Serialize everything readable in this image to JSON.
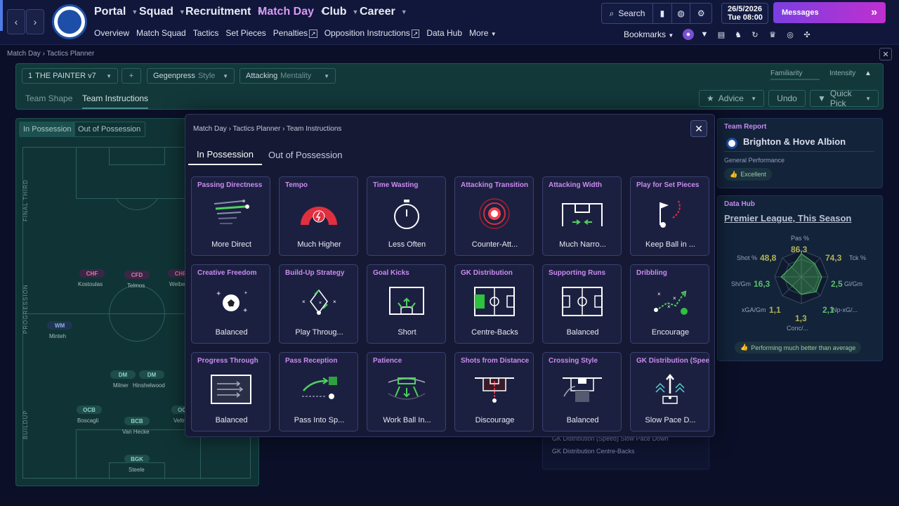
{
  "topnav": {
    "items": [
      "Portal",
      "Squad",
      "Recruitment",
      "Match Day",
      "Club",
      "Career"
    ],
    "active": "Match Day",
    "subnav": [
      "Overview",
      "Match Squad",
      "Tactics",
      "Set Pieces",
      "Penalties",
      "Opposition Instructions",
      "Data Hub",
      "More"
    ],
    "search_label": "Search",
    "date": "26/5/2026",
    "day_time": "Tue  08:00",
    "messages_label": "Messages",
    "bookmarks_label": "Bookmarks",
    "accent": "#c98bf0"
  },
  "breadcrumb": {
    "items": [
      "Match Day",
      "Tactics Planner"
    ]
  },
  "planner": {
    "tactic_number": "1",
    "tactic_name": "THE PAINTER v7",
    "add": "+",
    "style_value": "Gegenpress",
    "style_label": "Style",
    "mentality_value": "Attacking",
    "mentality_label": "Mentality",
    "familiarity": "Familiarity",
    "intensity": "Intensity",
    "tabs": [
      "Team Shape",
      "Team Instructions"
    ],
    "advice": "Advice",
    "undo": "Undo",
    "quick_pick": "Quick Pick"
  },
  "pitch": {
    "tabs": [
      "In Possession",
      "Out of Possession"
    ],
    "zones": [
      "FINAL THIRD",
      "PROGRESSION",
      "BUILDUP"
    ],
    "players": [
      {
        "pos": "CHF",
        "name": "Kostoulas",
        "type": "att"
      },
      {
        "pos": "CFD",
        "name": "Telmos",
        "type": "att"
      },
      {
        "pos": "CHF",
        "name": "Welbeck",
        "type": "att"
      },
      {
        "pos": "WM",
        "name": "Minteh",
        "type": "wm"
      },
      {
        "pos": "DM",
        "name": "Milner",
        "type": "mid"
      },
      {
        "pos": "DM",
        "name": "Hinshelwood",
        "type": "mid"
      },
      {
        "pos": "OCB",
        "name": "Boscagli",
        "type": "mid"
      },
      {
        "pos": "BCB",
        "name": "Van Hecke",
        "type": "mid"
      },
      {
        "pos": "OCB",
        "name": "Veltman",
        "type": "mid"
      },
      {
        "pos": "BGK",
        "name": "Steele",
        "type": "mid"
      }
    ]
  },
  "report": {
    "title": "Team Report",
    "club": "Brighton & Hove Albion",
    "perf_label": "General Performance",
    "perf_value": "Excellent"
  },
  "datahub": {
    "title": "Data Hub",
    "subtitle": "Premier League, This Season",
    "stats": {
      "pass": {
        "label": "Pas %",
        "value": "86,3"
      },
      "shot": {
        "label": "Shot %",
        "value": "48,8"
      },
      "tck": {
        "label": "Tck %",
        "value": "74,3"
      },
      "shgm": {
        "label": "Sh/Gm",
        "value": "16,3"
      },
      "glgm": {
        "label": "Gl/Gm",
        "value": "2,5"
      },
      "xga": {
        "label": "xGA/Gm",
        "value": "1,1"
      },
      "npxg": {
        "label": "Np-xG/...",
        "value": "2,1"
      },
      "conc": {
        "label": "Conc/...",
        "value": "1,3"
      }
    },
    "footer": "Performing much better than average"
  },
  "behind_list": [
    "GK Distribution (Speed)  Slow Pace Down",
    "GK Distribution  Centre-Backs"
  ],
  "modal": {
    "breadcrumb": [
      "Match Day",
      "Tactics Planner",
      "Team Instructions"
    ],
    "tabs": [
      "In Possession",
      "Out of Possession"
    ],
    "cards": [
      {
        "title": "Passing Directness",
        "value": "More Direct",
        "icon": "passing-directness-icon"
      },
      {
        "title": "Tempo",
        "value": "Much Higher",
        "icon": "tempo-gauge-icon"
      },
      {
        "title": "Time Wasting",
        "value": "Less Often",
        "icon": "stopwatch-icon"
      },
      {
        "title": "Attacking Transition",
        "value": "Counter-Att...",
        "icon": "transition-target-icon"
      },
      {
        "title": "Attacking Width",
        "value": "Much Narro...",
        "icon": "attacking-width-icon"
      },
      {
        "title": "Play for Set Pieces",
        "value": "Keep Ball in ...",
        "icon": "set-piece-flag-icon"
      },
      {
        "title": "Creative Freedom",
        "value": "Balanced",
        "icon": "creative-ball-icon"
      },
      {
        "title": "Build-Up Strategy",
        "value": "Play Throug...",
        "icon": "build-up-icon"
      },
      {
        "title": "Goal Kicks",
        "value": "Short",
        "icon": "goal-kick-icon"
      },
      {
        "title": "GK Distribution",
        "value": "Centre-Backs",
        "icon": "gk-distribution-icon"
      },
      {
        "title": "Supporting Runs",
        "value": "Balanced",
        "icon": "supporting-runs-icon"
      },
      {
        "title": "Dribbling",
        "value": "Encourage",
        "icon": "dribbling-icon"
      },
      {
        "title": "Progress Through",
        "value": "Balanced",
        "icon": "progress-through-icon"
      },
      {
        "title": "Pass Reception",
        "value": "Pass Into Sp...",
        "icon": "pass-reception-icon"
      },
      {
        "title": "Patience",
        "value": "Work Ball In...",
        "icon": "patience-icon"
      },
      {
        "title": "Shots from Distance",
        "value": "Discourage",
        "icon": "shots-distance-icon"
      },
      {
        "title": "Crossing Style",
        "value": "Balanced",
        "icon": "crossing-style-icon"
      },
      {
        "title": "GK Distribution (Speed)",
        "value": "Slow Pace D...",
        "icon": "gk-speed-icon"
      }
    ]
  }
}
